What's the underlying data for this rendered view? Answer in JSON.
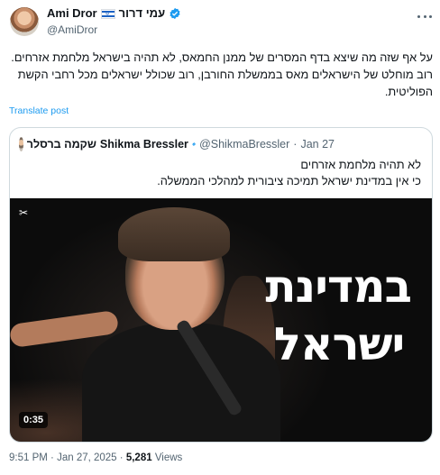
{
  "author": {
    "name": "Ami Dror",
    "name_hebrew": "עמי דרור",
    "handle": "@AmiDror"
  },
  "tweet": {
    "text": "על אף שזה מה שיצא בדף המסרים של ממנן החמאס, לא תהיה בישראל מלחמת אזרחים. רוב מוחלט של הישראלים מאס בממשלת החורבן, רוב שכולל ישראלים מכל רחבי הקשת הפוליטית.",
    "translate_label": "Translate post",
    "time": "9:51 PM",
    "date": "Jan 27, 2025",
    "separator": "·",
    "views_count": "5,281",
    "views_label": "Views"
  },
  "quote": {
    "name_hebrew": "שקמה ברסלר",
    "name": "Shikma Bressler",
    "handle": "@ShikmaBressler",
    "separator": "·",
    "date": "Jan 27",
    "text_line1": "לא תהיה מלחמת אזרחים",
    "text_line2": "כי אין במדינת ישראל תמיכה ציבורית למהלכי הממשלה.",
    "video": {
      "overlay_line1": "במדינת",
      "overlay_line2": "ישראל",
      "duration": "0:35"
    }
  },
  "colors": {
    "verified": "#1d9bf0",
    "link": "#1d9bf0",
    "secondary_text": "#536471"
  },
  "icons": [
    "verified-badge-icon",
    "israel-flag-icon",
    "more-icon",
    "capcut-icon"
  ]
}
